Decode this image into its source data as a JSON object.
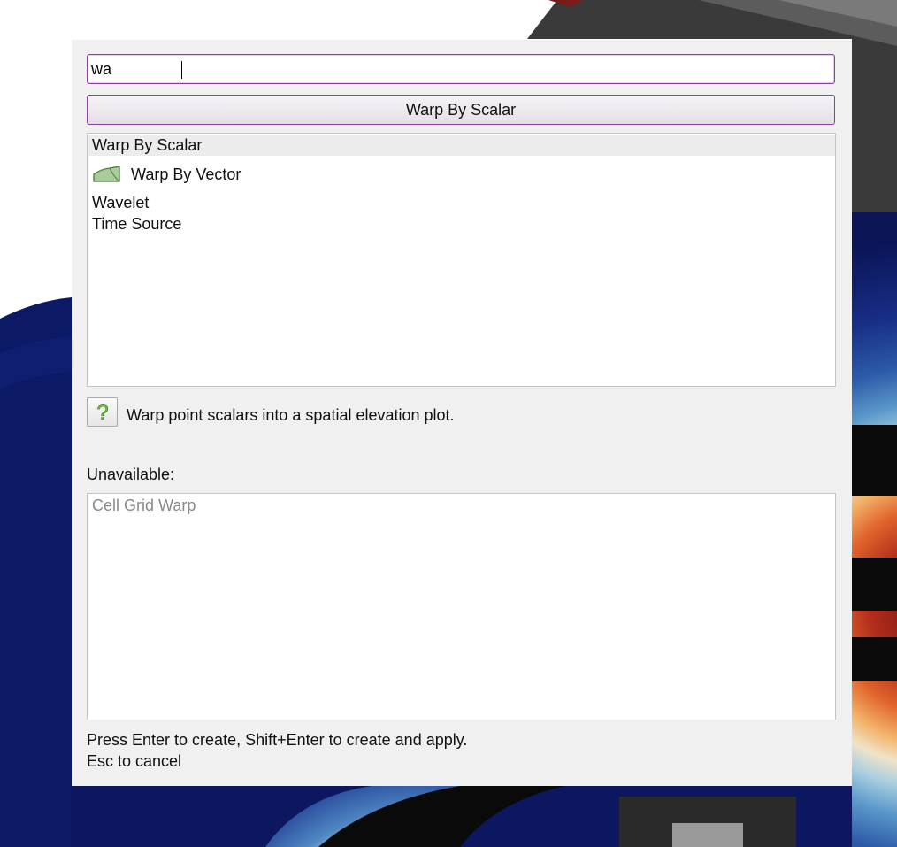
{
  "search": {
    "value": "wa"
  },
  "create_button": {
    "label": "Warp By Scalar"
  },
  "results": [
    {
      "label": "Warp By Scalar",
      "selected": true,
      "icon": null
    },
    {
      "label": "Warp By Vector",
      "selected": false,
      "icon": "warp-vector-icon"
    },
    {
      "label": "Wavelet",
      "selected": false,
      "icon": null
    },
    {
      "label": "Time Source",
      "selected": false,
      "icon": null
    }
  ],
  "help": {
    "icon": "help-question-icon",
    "glyph": "?",
    "description": "Warp point scalars into a spatial elevation plot."
  },
  "unavailable": {
    "heading": "Unavailable:",
    "items": [
      "Cell Grid Warp"
    ]
  },
  "hints": {
    "line1": "Press Enter to create, Shift+Enter to create and apply.",
    "line2": "Esc to cancel"
  },
  "colors": {
    "accent_border": "#8e3fa6",
    "dialog_bg": "#f0f0f0",
    "selected_row": "#ececec",
    "disabled_text": "#8a8a8a",
    "icon_fill": "#a9cc9a",
    "icon_stroke": "#4f7a3e"
  }
}
